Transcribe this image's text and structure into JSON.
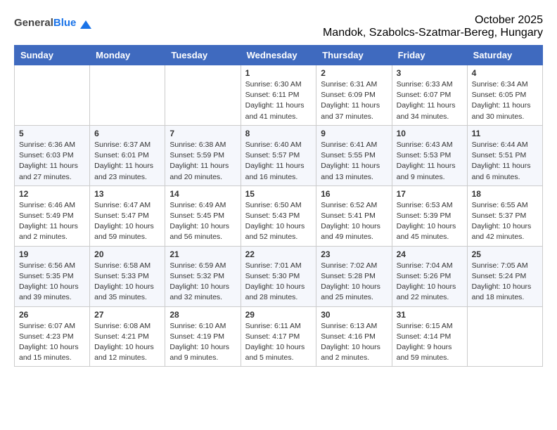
{
  "header": {
    "logo_general": "General",
    "logo_blue": "Blue",
    "month_year": "October 2025",
    "location": "Mandok, Szabolcs-Szatmar-Bereg, Hungary"
  },
  "days_of_week": [
    "Sunday",
    "Monday",
    "Tuesday",
    "Wednesday",
    "Thursday",
    "Friday",
    "Saturday"
  ],
  "weeks": [
    [
      {
        "day": "",
        "info": ""
      },
      {
        "day": "",
        "info": ""
      },
      {
        "day": "",
        "info": ""
      },
      {
        "day": "1",
        "info": "Sunrise: 6:30 AM\nSunset: 6:11 PM\nDaylight: 11 hours\nand 41 minutes."
      },
      {
        "day": "2",
        "info": "Sunrise: 6:31 AM\nSunset: 6:09 PM\nDaylight: 11 hours\nand 37 minutes."
      },
      {
        "day": "3",
        "info": "Sunrise: 6:33 AM\nSunset: 6:07 PM\nDaylight: 11 hours\nand 34 minutes."
      },
      {
        "day": "4",
        "info": "Sunrise: 6:34 AM\nSunset: 6:05 PM\nDaylight: 11 hours\nand 30 minutes."
      }
    ],
    [
      {
        "day": "5",
        "info": "Sunrise: 6:36 AM\nSunset: 6:03 PM\nDaylight: 11 hours\nand 27 minutes."
      },
      {
        "day": "6",
        "info": "Sunrise: 6:37 AM\nSunset: 6:01 PM\nDaylight: 11 hours\nand 23 minutes."
      },
      {
        "day": "7",
        "info": "Sunrise: 6:38 AM\nSunset: 5:59 PM\nDaylight: 11 hours\nand 20 minutes."
      },
      {
        "day": "8",
        "info": "Sunrise: 6:40 AM\nSunset: 5:57 PM\nDaylight: 11 hours\nand 16 minutes."
      },
      {
        "day": "9",
        "info": "Sunrise: 6:41 AM\nSunset: 5:55 PM\nDaylight: 11 hours\nand 13 minutes."
      },
      {
        "day": "10",
        "info": "Sunrise: 6:43 AM\nSunset: 5:53 PM\nDaylight: 11 hours\nand 9 minutes."
      },
      {
        "day": "11",
        "info": "Sunrise: 6:44 AM\nSunset: 5:51 PM\nDaylight: 11 hours\nand 6 minutes."
      }
    ],
    [
      {
        "day": "12",
        "info": "Sunrise: 6:46 AM\nSunset: 5:49 PM\nDaylight: 11 hours\nand 2 minutes."
      },
      {
        "day": "13",
        "info": "Sunrise: 6:47 AM\nSunset: 5:47 PM\nDaylight: 10 hours\nand 59 minutes."
      },
      {
        "day": "14",
        "info": "Sunrise: 6:49 AM\nSunset: 5:45 PM\nDaylight: 10 hours\nand 56 minutes."
      },
      {
        "day": "15",
        "info": "Sunrise: 6:50 AM\nSunset: 5:43 PM\nDaylight: 10 hours\nand 52 minutes."
      },
      {
        "day": "16",
        "info": "Sunrise: 6:52 AM\nSunset: 5:41 PM\nDaylight: 10 hours\nand 49 minutes."
      },
      {
        "day": "17",
        "info": "Sunrise: 6:53 AM\nSunset: 5:39 PM\nDaylight: 10 hours\nand 45 minutes."
      },
      {
        "day": "18",
        "info": "Sunrise: 6:55 AM\nSunset: 5:37 PM\nDaylight: 10 hours\nand 42 minutes."
      }
    ],
    [
      {
        "day": "19",
        "info": "Sunrise: 6:56 AM\nSunset: 5:35 PM\nDaylight: 10 hours\nand 39 minutes."
      },
      {
        "day": "20",
        "info": "Sunrise: 6:58 AM\nSunset: 5:33 PM\nDaylight: 10 hours\nand 35 minutes."
      },
      {
        "day": "21",
        "info": "Sunrise: 6:59 AM\nSunset: 5:32 PM\nDaylight: 10 hours\nand 32 minutes."
      },
      {
        "day": "22",
        "info": "Sunrise: 7:01 AM\nSunset: 5:30 PM\nDaylight: 10 hours\nand 28 minutes."
      },
      {
        "day": "23",
        "info": "Sunrise: 7:02 AM\nSunset: 5:28 PM\nDaylight: 10 hours\nand 25 minutes."
      },
      {
        "day": "24",
        "info": "Sunrise: 7:04 AM\nSunset: 5:26 PM\nDaylight: 10 hours\nand 22 minutes."
      },
      {
        "day": "25",
        "info": "Sunrise: 7:05 AM\nSunset: 5:24 PM\nDaylight: 10 hours\nand 18 minutes."
      }
    ],
    [
      {
        "day": "26",
        "info": "Sunrise: 6:07 AM\nSunset: 4:23 PM\nDaylight: 10 hours\nand 15 minutes."
      },
      {
        "day": "27",
        "info": "Sunrise: 6:08 AM\nSunset: 4:21 PM\nDaylight: 10 hours\nand 12 minutes."
      },
      {
        "day": "28",
        "info": "Sunrise: 6:10 AM\nSunset: 4:19 PM\nDaylight: 10 hours\nand 9 minutes."
      },
      {
        "day": "29",
        "info": "Sunrise: 6:11 AM\nSunset: 4:17 PM\nDaylight: 10 hours\nand 5 minutes."
      },
      {
        "day": "30",
        "info": "Sunrise: 6:13 AM\nSunset: 4:16 PM\nDaylight: 10 hours\nand 2 minutes."
      },
      {
        "day": "31",
        "info": "Sunrise: 6:15 AM\nSunset: 4:14 PM\nDaylight: 9 hours\nand 59 minutes."
      },
      {
        "day": "",
        "info": ""
      }
    ]
  ]
}
